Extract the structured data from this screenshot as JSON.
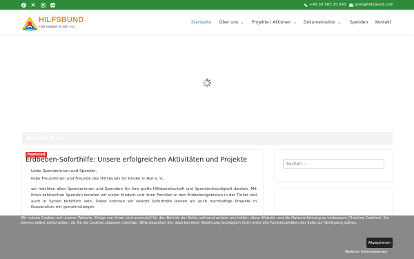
{
  "topbar": {
    "social": [
      {
        "icon": "facebook-icon",
        "glyph": "f"
      },
      {
        "icon": "x-icon",
        "glyph": "𝕏"
      },
      {
        "icon": "instagram-icon",
        "glyph": "◎"
      },
      {
        "icon": "flickr-icon",
        "glyph": "•"
      }
    ],
    "phone": "+49 30 983 25 543",
    "email": "post@hilfsbund.com"
  },
  "header": {
    "logo_name": "HILFSBUND",
    "logo_sub": "FÜR KINDER IN NOT e.V.",
    "nav": [
      {
        "label": "Startseite",
        "active": true
      },
      {
        "label": "Über uns",
        "dropdown": true
      },
      {
        "label": "Projekte / Aktionen",
        "dropdown": true
      },
      {
        "label": "Dokumentation",
        "dropdown": true
      },
      {
        "label": "Spenden"
      },
      {
        "label": "Kontakt"
      }
    ]
  },
  "page": {
    "title_bar": "Aktuelle Seite"
  },
  "post": {
    "badge": "Featured",
    "title": "Erdbeben-Soforthilfe: Unsere erfolgreichen Aktivitäten und Projekte",
    "greeting1": "Liebe Spenderinnen und Spender,",
    "greeting2": "liebe Freundinnen und Freunde des Hilfsbunds für Kinder in Not e. V.,",
    "paragraph": "wir möchten allen Spenderinnen und Spendern für ihre große Hilfsbereitschaft und Spendenfreudigkeit danken. Mit Ihren zahlreichen Spenden konnten wir vielen Kindern und Ihren Familien in den Erdbebengebieten in der Türkei und auch in Syrien behilflich sein. Dabei konnten wir sowohl Soforthilfe leisten als auch nachhaltige Projekte in Kooperation mit gemeinnützigen"
  },
  "sidebar": {
    "search_placeholder": "Suchen ..."
  },
  "cookie": {
    "text": "Wir nutzen Cookies auf unserer Website. Einige von ihnen sind essenziell für den Betrieb der Seite, während andere uns helfen, diese Website und die Nutzererfahrung zu verbessern (Tracking Cookies). Sie können selbst entscheiden, ob Sie die Cookies zulassen möchten. Bitte beachten Sie, dass bei einer Ablehnung womöglich nicht mehr alle Funktionalitäten der Seite zur Verfügung stehen.",
    "accept_label": "Akzeptieren",
    "more_label": "Weitere Informationen"
  },
  "colors": {
    "brand_green": "#2e8b3c",
    "nav_active": "#2e7fd0",
    "logo_orange": "#e48a1a",
    "badge_red": "#e53935"
  }
}
